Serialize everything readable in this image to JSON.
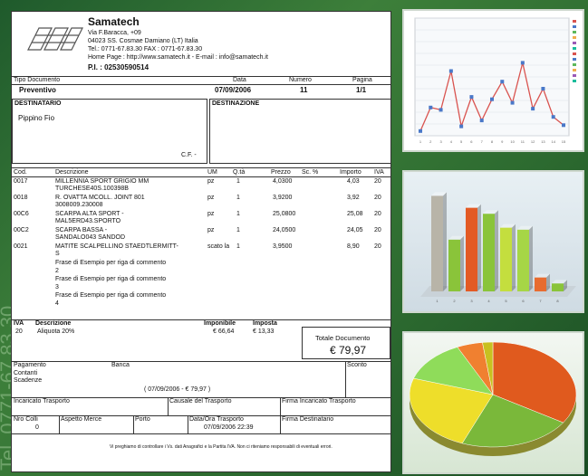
{
  "company": {
    "name": "Samatech",
    "address1": "Via F.Baracca, +09",
    "address2": "04023 SS. Cosmae Damiano (LT) Italia",
    "contacts": "Tel.: 0771-67.83.30 FAX : 0771-67.83.30",
    "web": "Home Page : http://www.samatech.it  - E-mail : info@samatech.it",
    "piva": "P.I. : 02530590514"
  },
  "doc_header": {
    "labels": [
      "Tipo Documento",
      "Data",
      "Numero",
      "Pagina"
    ],
    "values": [
      "Preventivo",
      "07/09/2006",
      "11",
      "1/1"
    ]
  },
  "destinatario": {
    "label": "DESTINATARIO",
    "name": "Pippino Fio",
    "cf_label": "C.F. -"
  },
  "destinazione": {
    "label": "DESTINAZIONE"
  },
  "items_header": [
    "Cod.",
    "Descrizione",
    "UM",
    "Q.tà",
    "Prezzo",
    "Sc. %",
    "Importo",
    "IVA"
  ],
  "items": [
    {
      "cod": "0017",
      "desc": [
        "MILLENNIA SPORT GRIGIO MM",
        "TURCHESE40S.100398B"
      ],
      "um": "pz",
      "qty": "1",
      "price": "4,0300",
      "sc": "",
      "imp": "4,03",
      "iva": "20"
    },
    {
      "cod": "0018",
      "desc": [
        "R. OVATTA MCOLL. JOINT 801",
        "3008009.230008"
      ],
      "um": "pz",
      "qty": "1",
      "price": "3,9200",
      "sc": "",
      "imp": "3,92",
      "iva": "20"
    },
    {
      "cod": "00C6",
      "desc": [
        "SCARPA ALTA SPORT -",
        "MAL5ERD43.SPORTO"
      ],
      "um": "pz",
      "qty": "1",
      "price": "25,0800",
      "sc": "",
      "imp": "25,08",
      "iva": "20"
    },
    {
      "cod": "00C2",
      "desc": [
        "SCARPA BASSA -",
        "SANDALO043 SANDOD"
      ],
      "um": "pz",
      "qty": "1",
      "price": "24,0500",
      "sc": "",
      "imp": "24,05",
      "iva": "20"
    },
    {
      "cod": "0021",
      "desc": [
        "MATITE SCALPELLINO STAEDTLERMITT-",
        "S"
      ],
      "um": "scato la",
      "qty": "1",
      "price": "3,9500",
      "sc": "",
      "imp": "8,90",
      "iva": "20"
    }
  ],
  "comments": [
    [
      "Frase di Esempio per riga di commento",
      "2"
    ],
    [
      "Frase di Esempio per riga di commento",
      "3"
    ],
    [
      "Frase di Esempio per riga di commento",
      "4"
    ]
  ],
  "iva_header": [
    "IVA",
    "Descrizione",
    "Imponibile",
    "Imposta"
  ],
  "iva_row": [
    "20",
    "Aliquota 20%",
    "€ 66,64",
    "€ 13,33"
  ],
  "totale": {
    "label": "Totale Documento",
    "value": "€ 79,97"
  },
  "pagamento": {
    "labels": [
      "Pagamento",
      "Banca",
      "Sconto"
    ],
    "lines": [
      "Contanti",
      "Scadenze"
    ],
    "scadenza": "( 07/09/2006 - € 79,97 )"
  },
  "trasporto": {
    "labels": [
      "Incaricato Trasporto",
      "Causale del Trasporto",
      "Firma Incaricato Trasporto"
    ]
  },
  "colli": {
    "labels": [
      "Nro Colli",
      "Aspetto Merce",
      "Porto",
      "Data/Ora Trasporto",
      "Firma Destinatario"
    ],
    "values": [
      "0",
      "",
      "",
      "07/09/2006 22:39",
      ""
    ]
  },
  "footer_note": "Vi preghiamo di controllare i Vs. dati Anagrafici e la Partita IVA. Non ci riteniamo responsabili di eventuali errori.",
  "side_watermark": "Tel. 0771-67.83.30",
  "chart_data": [
    {
      "type": "line",
      "x": [
        "1",
        "2",
        "3",
        "4",
        "5",
        "6",
        "7",
        "8",
        "9",
        "10",
        "11",
        "12",
        "13",
        "14",
        "15"
      ],
      "series": [
        {
          "values": [
            4,
            24,
            22,
            55,
            8,
            33,
            13,
            31,
            46,
            28,
            62,
            23,
            40,
            16,
            9
          ]
        }
      ],
      "ylim": [
        0,
        100
      ]
    },
    {
      "type": "bar",
      "categories": [
        "1",
        "2",
        "3",
        "4",
        "5",
        "6",
        "7",
        "8"
      ],
      "values": [
        96,
        52,
        84,
        78,
        64,
        62,
        14,
        8
      ]
    },
    {
      "type": "pie",
      "values": [
        34,
        22,
        24,
        13,
        5,
        2
      ],
      "colors": [
        "#e05a1e",
        "#7ab83a",
        "#eede2a",
        "#8fdc5a",
        "#f08030",
        "#c8c020"
      ]
    }
  ]
}
